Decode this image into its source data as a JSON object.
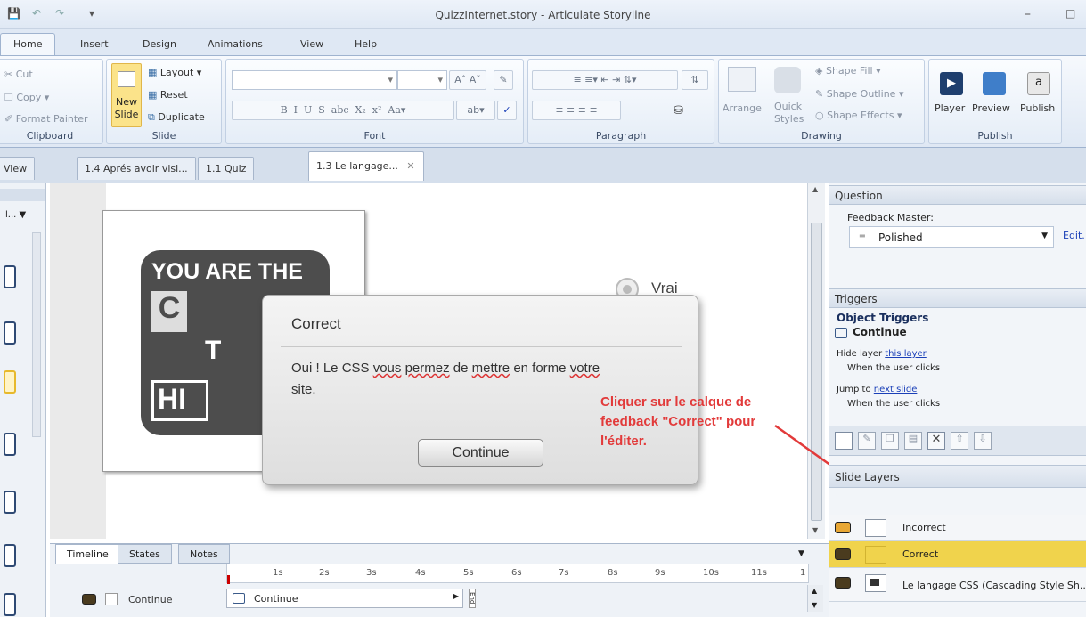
{
  "window": {
    "title": "QuizzInternet.story - Articulate Storyline"
  },
  "menu": {
    "tabs": [
      "Home",
      "Insert",
      "Design",
      "Animations",
      "View",
      "Help"
    ]
  },
  "ribbon": {
    "clipboard": {
      "cut": "Cut",
      "copy": "Copy",
      "format_painter": "Format Painter",
      "label": "Clipboard"
    },
    "slide": {
      "new_slide_1": "New",
      "new_slide_2": "Slide",
      "layout": "Layout",
      "reset": "Reset",
      "duplicate": "Duplicate",
      "label": "Slide"
    },
    "font": {
      "label": "Font"
    },
    "paragraph": {
      "label": "Paragraph"
    },
    "drawing": {
      "arrange": "Arrange",
      "quick_styles_1": "Quick",
      "quick_styles_2": "Styles",
      "shape_fill": "Shape Fill",
      "shape_outline": "Shape Outline",
      "shape_effects": "Shape Effects",
      "label": "Drawing"
    },
    "publish": {
      "player": "Player",
      "preview": "Preview",
      "publish": "Publish",
      "label": "Publish"
    }
  },
  "doc_tabs": [
    "View",
    "1.4 Aprés avoir visi...",
    "1.1 Quiz",
    "1.3 Le langage..."
  ],
  "slide": {
    "image_text_1": "YOU ARE THE",
    "image_letter_c": "C",
    "image_letter_t": "T",
    "image_letters_hi": "HI",
    "option_vrai": "Vrai",
    "dialog_title": "Correct",
    "dialog_body_1": "Oui ! Le CSS ",
    "dialog_body_vous": "vous",
    "dialog_body_2": " ",
    "dialog_body_permez": "permez",
    "dialog_body_3": " de ",
    "dialog_body_mettre": "mettre",
    "dialog_body_4": " en forme ",
    "dialog_body_votre": "votre",
    "dialog_body_5": "site.",
    "continue_button": "Continue"
  },
  "annotation": {
    "line1": "Cliquer sur le calque de",
    "line2": "feedback \"Correct\" pour",
    "line3": "l'éditer.",
    "color": "#e23a3a"
  },
  "right_panel": {
    "question_header": "Question",
    "feedback_master_label": "Feedback Master:",
    "feedback_master_value": "Polished",
    "edit_link": "Edit.",
    "triggers_header": "Triggers",
    "object_triggers": "Object Triggers",
    "trigger_object": "Continue",
    "trigger1_action": "Hide layer",
    "trigger1_target": "this layer",
    "trigger1_when": "When the user clicks",
    "trigger2_action": "Jump to",
    "trigger2_target": "next slide",
    "trigger2_when": "When the user clicks",
    "layers_header": "Slide Layers",
    "layers": [
      "Incorrect",
      "Correct",
      "Le langage CSS (Cascading Style Sh..."
    ]
  },
  "timeline": {
    "tabs": [
      "Timeline",
      "States",
      "Notes"
    ],
    "ticks": [
      "1s",
      "2s",
      "3s",
      "4s",
      "5s",
      "6s",
      "7s",
      "8s",
      "9s",
      "10s",
      "11s",
      "1"
    ],
    "row_label": "Continue",
    "bar_label": "Continue",
    "end_label": "End"
  },
  "colors": {
    "selected_layer": "#f0d34c",
    "accent_blue": "#1a3fb8"
  }
}
